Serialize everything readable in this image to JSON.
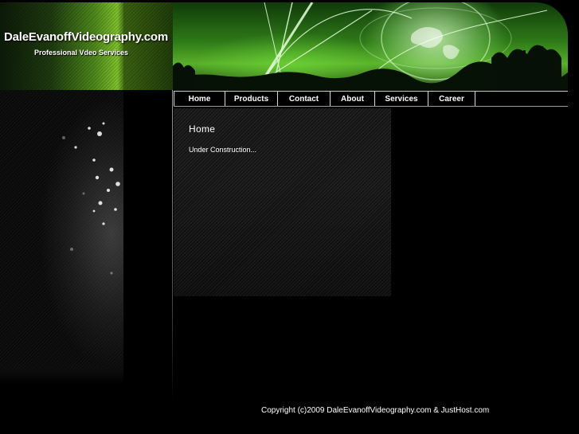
{
  "site": {
    "title": "DaleEvanoffVideography.com",
    "tagline": "Professional Vdeo Services"
  },
  "nav": {
    "items": [
      {
        "label": "Home"
      },
      {
        "label": "Products"
      },
      {
        "label": "Contact"
      },
      {
        "label": "About"
      },
      {
        "label": "Services"
      },
      {
        "label": "Career"
      }
    ]
  },
  "main": {
    "heading": "Home",
    "body": "Under Construction..."
  },
  "footer": {
    "copyright": "Copyright (c)2009 DaleEvanoffVideography.com & JustHost.com"
  },
  "colors": {
    "background": "#000000",
    "accent_green": "#5fb02a",
    "text": "#ffffff"
  }
}
